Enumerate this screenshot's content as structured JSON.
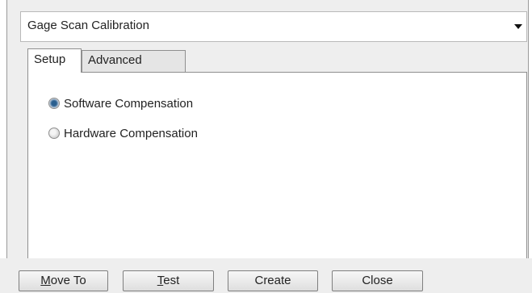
{
  "dropdown": {
    "selected": "Gage Scan Calibration",
    "arrow_icon": "chevron-down-icon"
  },
  "tabs": [
    {
      "label": "Setup",
      "active": true
    },
    {
      "label": "Advanced",
      "active": false
    }
  ],
  "options": [
    {
      "label": "Software Compensation",
      "checked": true
    },
    {
      "label": "Hardware Compensation",
      "checked": false
    }
  ],
  "buttons": {
    "move_to": {
      "first": "M",
      "rest": "ove To"
    },
    "test": {
      "first": "T",
      "rest": "est"
    },
    "create": "Create",
    "close": "Close"
  },
  "colors": {
    "panel_bg": "#eeeeee",
    "content_bg": "#ffffff",
    "radio_checked": "#2a5f8f"
  }
}
